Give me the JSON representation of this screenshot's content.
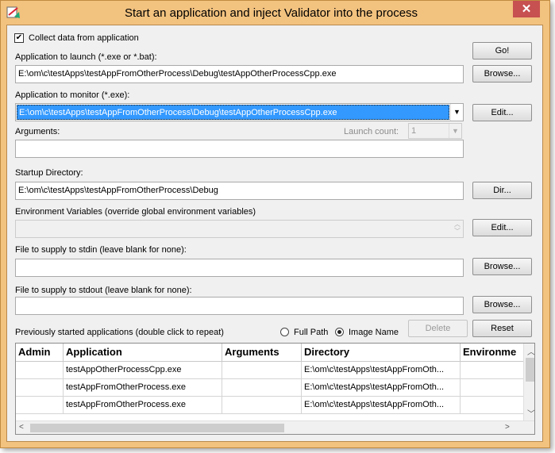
{
  "window": {
    "title": "Start an application and inject Validator into the process",
    "close_glyph": "✕"
  },
  "form": {
    "collect_label": "Collect data from application",
    "collect_checked": true,
    "launch_label": "Application to launch (*.exe or *.bat):",
    "launch_value": "E:\\om\\c\\testApps\\testAppFromOtherProcess\\Debug\\testAppOtherProcessCpp.exe",
    "monitor_label": "Application to monitor (*.exe):",
    "monitor_value": "E:\\om\\c\\testApps\\testAppFromOtherProcess\\Debug\\testAppOtherProcessCpp.exe",
    "arguments_label": "Arguments:",
    "arguments_value": "",
    "launch_count_label": "Launch count:",
    "launch_count_value": "1",
    "startup_label": "Startup Directory:",
    "startup_value": "E:\\om\\c\\testApps\\testAppFromOtherProcess\\Debug",
    "env_label": "Environment Variables (override global environment variables)",
    "env_value": "",
    "stdin_label": "File to supply to stdin (leave blank for none):",
    "stdin_value": "",
    "stdout_label": "File to supply to stdout (leave blank for none):",
    "stdout_value": "",
    "previous_label": "Previously started applications (double click to repeat)",
    "full_path_label": "Full Path",
    "image_name_label": "Image Name",
    "image_name_selected": true
  },
  "buttons": {
    "go": "Go!",
    "browse_launch": "Browse...",
    "edit_monitor": "Edit...",
    "dir": "Dir...",
    "edit_env": "Edit...",
    "browse_stdin": "Browse...",
    "browse_stdout": "Browse...",
    "delete": "Delete",
    "reset": "Reset"
  },
  "table": {
    "columns": [
      "Admin",
      "Application",
      "Arguments",
      "Directory",
      "Environme"
    ],
    "rows": [
      {
        "admin": "",
        "application": "testAppOtherProcessCpp.exe",
        "arguments": "",
        "directory": "E:\\om\\c\\testApps\\testAppFromOth...",
        "environment": ""
      },
      {
        "admin": "",
        "application": "testAppFromOtherProcess.exe",
        "arguments": "",
        "directory": "E:\\om\\c\\testApps\\testAppFromOth...",
        "environment": ""
      },
      {
        "admin": "",
        "application": "testAppFromOtherProcess.exe",
        "arguments": "",
        "directory": "E:\\om\\c\\testApps\\testAppFromOth...",
        "environment": ""
      }
    ]
  },
  "icons": {
    "app": "validator-app-icon",
    "close": "close-icon",
    "combo": "chevron-down-icon",
    "spin": "spinner-icon"
  },
  "colors": {
    "titlebar": "#f2c27f",
    "close": "#c75050",
    "selection": "#3399ff"
  }
}
